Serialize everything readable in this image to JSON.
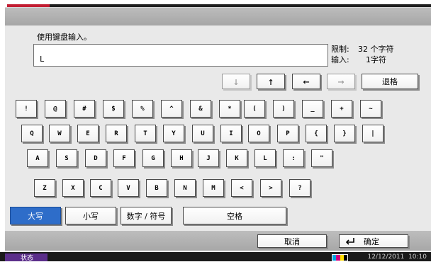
{
  "prompt": "使用键盘输入。",
  "input_value": "L",
  "limit_label": "限制:",
  "limit_value": "32 个字符",
  "entered_label": "输入:",
  "entered_value": "1字符",
  "nav": {
    "down": "↓",
    "up": "↑",
    "left": "←",
    "right": "→",
    "backspace": "退格"
  },
  "keys": {
    "row1": [
      "!",
      "@",
      "#",
      "$",
      "%",
      "^",
      "&",
      "*",
      "(",
      ")",
      "_",
      "+",
      "~"
    ],
    "row2": [
      "Q",
      "W",
      "E",
      "R",
      "T",
      "Y",
      "U",
      "I",
      "O",
      "P",
      "{",
      "}",
      "|"
    ],
    "row3": [
      "A",
      "S",
      "D",
      "F",
      "G",
      "H",
      "J",
      "K",
      "L",
      ":",
      "\""
    ],
    "row4": [
      "Z",
      "X",
      "C",
      "V",
      "B",
      "N",
      "M",
      "<",
      ">",
      "?"
    ]
  },
  "modes": {
    "upper": "大写",
    "lower": "小写",
    "numsym": "数字 / 符号",
    "space": "空格"
  },
  "footer": {
    "cancel": "取消",
    "ok": "确定",
    "ok_icon": "enter-arrow-icon"
  },
  "statusbar": {
    "status": "状态",
    "datetime": "12/12/2011  10:10",
    "toner_icon": "toner-level-icon"
  },
  "colors": {
    "accent_red": "#c21d32",
    "selected_blue": "#2e6dc9",
    "status_purple": "#5b2e8a"
  }
}
